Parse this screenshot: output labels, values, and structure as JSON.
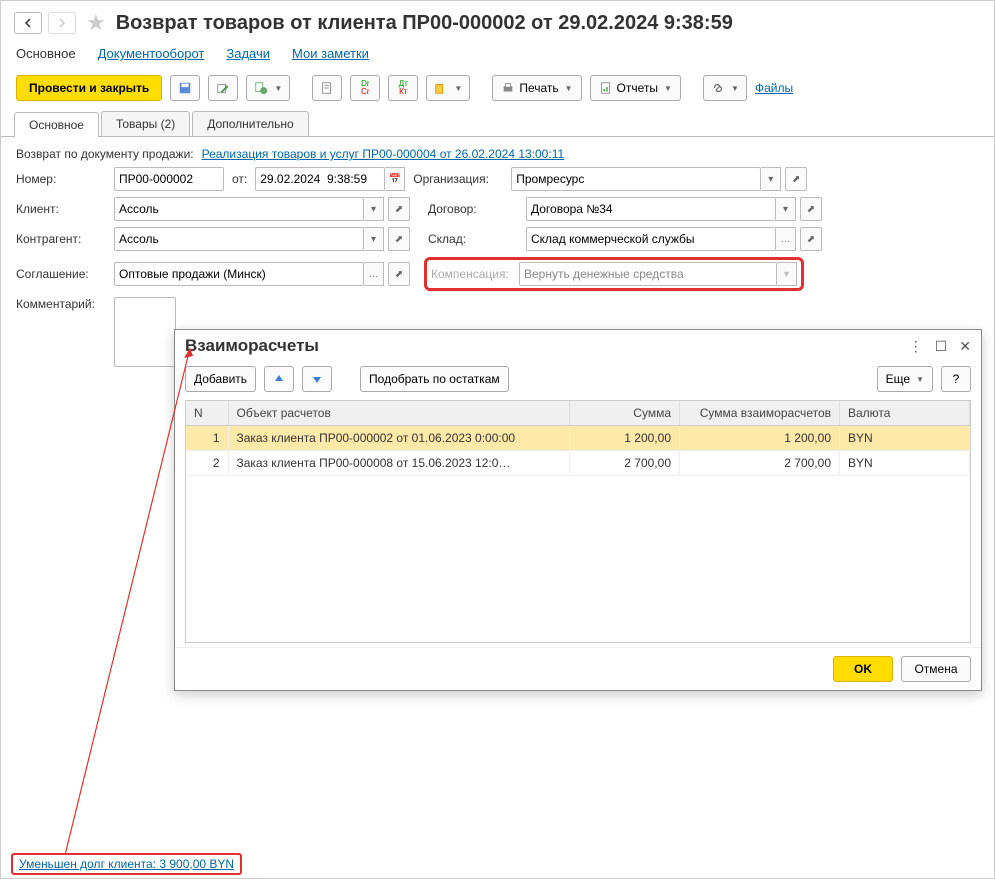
{
  "header": {
    "title": "Возврат товаров от клиента ПР00-000002 от 29.02.2024 9:38:59"
  },
  "menu": {
    "main": "Основное",
    "docflow": "Документооборот",
    "tasks": "Задачи",
    "notes": "Мои заметки"
  },
  "toolbar": {
    "post_close": "Провести и закрыть",
    "print": "Печать",
    "reports": "Отчеты",
    "files": "Файлы"
  },
  "tabs": {
    "t1": "Основное",
    "t2": "Товары (2)",
    "t3": "Дополнительно"
  },
  "form": {
    "return_by_label": "Возврат по документу продажи:",
    "return_by_link": "Реализация товаров и услуг ПР00-000004 от 26.02.2024 13:00:11",
    "number_lbl": "Номер:",
    "number": "ПР00-000002",
    "from_lbl": "от:",
    "date": "29.02.2024  9:38:59",
    "org_lbl": "Организация:",
    "org": "Промресурс",
    "client_lbl": "Клиент:",
    "client": "Ассоль",
    "contract_lbl": "Договор:",
    "contract": "Договора №34",
    "counterparty_lbl": "Контрагент:",
    "counterparty": "Ассоль",
    "warehouse_lbl": "Склад:",
    "warehouse": "Склад коммерческой службы",
    "agreement_lbl": "Соглашение:",
    "agreement": "Оптовые продажи (Минск)",
    "compensation_lbl": "Компенсация:",
    "compensation": "Вернуть денежные средства",
    "comment_lbl": "Комментарий:"
  },
  "dialog": {
    "title": "Взаиморасчеты",
    "add": "Добавить",
    "pick": "Подобрать по остаткам",
    "more": "Еще",
    "help": "?",
    "ok": "OK",
    "cancel": "Отмена",
    "cols": {
      "n": "N",
      "obj": "Объект расчетов",
      "sum": "Сумма",
      "sum_settle": "Сумма взаиморасчетов",
      "curr": "Валюта"
    },
    "rows": [
      {
        "n": "1",
        "obj": "Заказ клиента ПР00-000002 от 01.06.2023 0:00:00",
        "sum": "1 200,00",
        "sum_settle": "1 200,00",
        "curr": "BYN"
      },
      {
        "n": "2",
        "obj": "Заказ клиента ПР00-000008 от 15.06.2023 12:0…",
        "sum": "2 700,00",
        "sum_settle": "2 700,00",
        "curr": "BYN"
      }
    ]
  },
  "status": {
    "text": "Уменьшен долг клиента: 3 900,00 BYN"
  }
}
